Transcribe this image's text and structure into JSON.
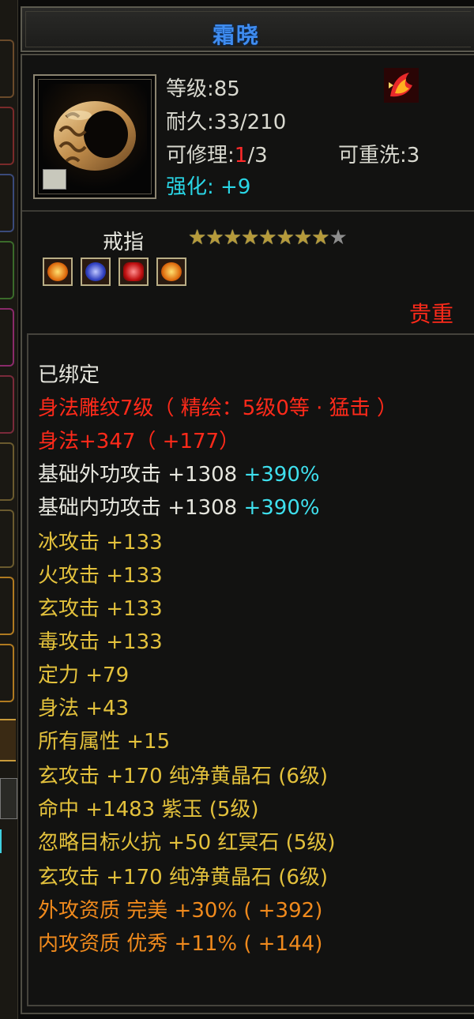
{
  "item": {
    "name": "霜晓",
    "level": "等级:85",
    "durability": {
      "label": "耐久:",
      "value": "33/210"
    },
    "repairable": {
      "label": "可修理:",
      "current": "1",
      "total": "/3"
    },
    "rewashable": "可重洗:3",
    "enhance": {
      "label": "强化:",
      "value": "+9"
    },
    "type": "戒指",
    "stars_filled": 8,
    "stars_total": 9,
    "rarity": "贵重",
    "colors": {
      "name": "#3f8cf0",
      "enhance": "#29d6e6",
      "rarity": "#ff2a1a",
      "star": "#b59a3a"
    }
  },
  "icons": {
    "item_icon": "ring-icon",
    "badge": "bound-badge-icon",
    "top_right": "fire-emblem-icon",
    "gems": [
      "gem-fire-icon",
      "gem-blue-icon",
      "gem-red-icon",
      "gem-fire-icon"
    ]
  },
  "attributes": {
    "bound": "已绑定",
    "engraving": "身法雕纹7级（ 精绘：5级0等 · 猛击 ）",
    "agility_bonus": "身法+347（ +177）",
    "base_ext_attack": {
      "text": "基础外功攻击  +1308",
      "pct": "+390%"
    },
    "base_int_attack": {
      "text": "基础内功攻击  +1308",
      "pct": "+390%"
    },
    "ice_attack": "冰攻击  +133",
    "fire_attack": "火攻击  +133",
    "mystic_attack": "玄攻击  +133",
    "poison_attack": "毒攻击  +133",
    "focus": "定力  +79",
    "agility": "身法  +43",
    "all_attr": "所有属性  +15",
    "gem1": "玄攻击  +170  纯净黄晶石 (6级)",
    "gem2": "命中  +1483  紫玉 (5级)",
    "gem3": "忽略目标火抗  +50  红冥石 (5级)",
    "gem4": "玄攻击  +170  纯净黄晶石 (6级)",
    "ext_quality": "外攻资质  完美  +30%  ( +392)",
    "int_quality": "内攻资质  优秀  +11%  ( +144)"
  }
}
